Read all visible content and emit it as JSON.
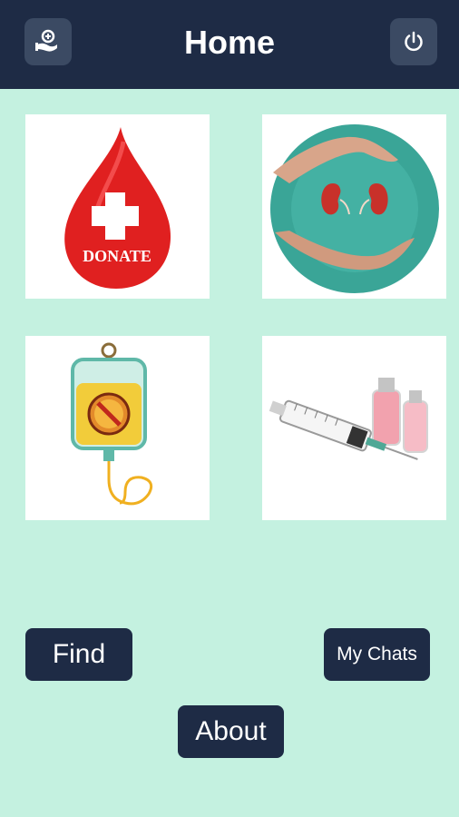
{
  "header": {
    "title": "Home",
    "left_icon": "donor-hand-icon",
    "right_icon": "power-icon"
  },
  "tiles": [
    {
      "name": "blood-donation",
      "icon": "blood-drop-donate",
      "caption": "DONATE"
    },
    {
      "name": "kidney-donation",
      "icon": "kidneys-in-hands"
    },
    {
      "name": "plasma-donation",
      "icon": "iv-bag"
    },
    {
      "name": "vaccine",
      "icon": "syringe-and-vials"
    }
  ],
  "buttons": {
    "find": "Find",
    "my_chats": "My Chats",
    "about": "About"
  },
  "colors": {
    "background": "#c4f1e0",
    "appbar": "#1e2b45",
    "button": "#1e2b45",
    "icon_button": "#3b4a63"
  }
}
